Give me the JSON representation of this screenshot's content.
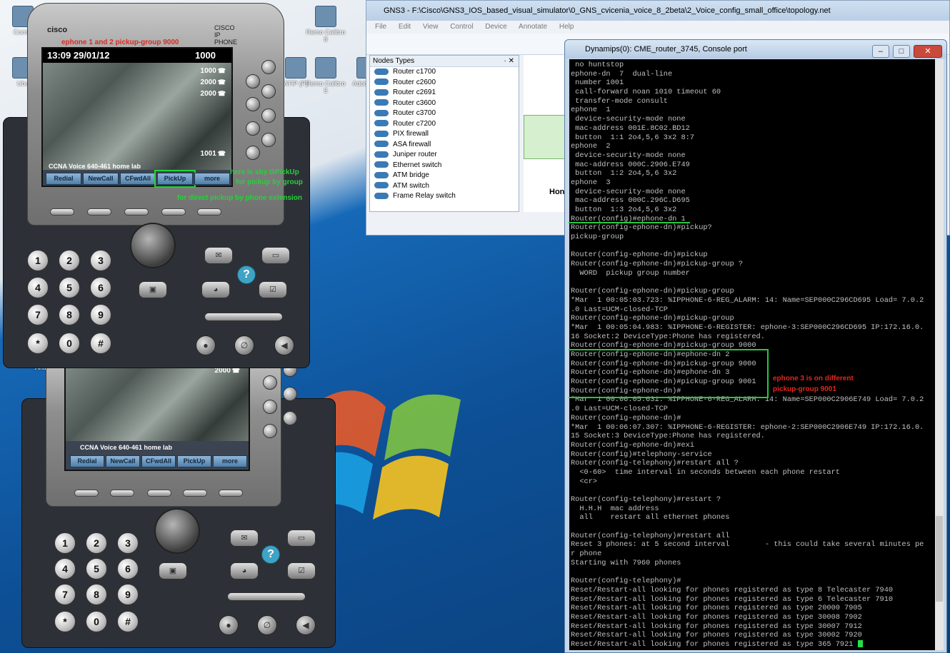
{
  "gns3": {
    "title": "GNS3 - F:\\Cisco\\GNS3_IOS_based_visual_simulator\\0_GNS_cvicenia_voice_8_2beta\\2_Voice_config_small_office\\topology.net",
    "menu": [
      "File",
      "Edit",
      "View",
      "Control",
      "Device",
      "Annotate",
      "Help"
    ],
    "nodes_title": "Nodes Types",
    "nodes_ctrl": "· ✕",
    "nodes": [
      "Router c1700",
      "Router c2600",
      "Router c2691",
      "Router c3600",
      "Router c3700",
      "Router c7200",
      "PIX firewall",
      "ASA firewall",
      "Juniper router",
      "Ethernet switch",
      "ATM bridge",
      "ATM switch",
      "Frame Relay switch"
    ],
    "canvas_label": "Hon"
  },
  "desktop_icons": [
    {
      "label": "Comm"
    },
    {
      "label": "Ubu"
    },
    {
      "label": "Antivi"
    },
    {
      "label": "Remo Calibro 8"
    },
    {
      "label": "Remo Calibro 5"
    },
    {
      "label": "Adob PDF"
    },
    {
      "label": "ATIP (P)"
    }
  ],
  "console": {
    "title": "Dynamips(0): CME_router_3745, Console port",
    "btn_min": "–",
    "btn_max": "□",
    "btn_close": "✕",
    "lines": [
      " no huntstop",
      "ephone-dn  7  dual-line",
      " number 1001",
      " call-forward noan 1010 timeout 60",
      " transfer-mode consult",
      "ephone  1",
      " device-security-mode none",
      " mac-address 001E.8C02.BD12",
      " button  1:1 2o4,5,6 3x2 8:7",
      "ephone  2",
      " device-security-mode none",
      " mac-address 000C.2906.E749",
      " button  1:2 2o4,5,6 3x2",
      "ephone  3",
      " device-security-mode none",
      " mac-address 000C.296C.D695",
      " button  1:3 2o4,5,6 3x2",
      "Router(config)#ephone-dn 1",
      "Router(config-ephone-dn)#pickup?",
      "pickup-group",
      "",
      "Router(config-ephone-dn)#pickup",
      "Router(config-ephone-dn)#pickup-group ?",
      "  WORD  pickup group number",
      "",
      "Router(config-ephone-dn)#pickup-group",
      "*Mar  1 00:05:03.723: %IPPHONE-6-REG_ALARM: 14: Name=SEP000C296CD695 Load= 7.0.2",
      ".0 Last=UCM-closed-TCP",
      "Router(config-ephone-dn)#pickup-group",
      "*Mar  1 00:05:04.983: %IPPHONE-6-REGISTER: ephone-3:SEP000C296CD695 IP:172.16.0.",
      "16 Socket:2 DeviceType:Phone has registered.",
      "Router(config-ephone-dn)#pickup-group 9000",
      "Router(config-ephone-dn)#ephone-dn 2",
      "Router(config-ephone-dn)#pickup-group 9000",
      "Router(config-ephone-dn)#ephone-dn 3",
      "Router(config-ephone-dn)#pickup-group 9001",
      "Router(config-ephone-dn)#",
      "*Mar  1 00:06:05.631: %IPPHONE-6-REG_ALARM: 14: Name=SEP000C2906E749 Load= 7.0.2",
      ".0 Last=UCM-closed-TCP",
      "Router(config-ephone-dn)#",
      "*Mar  1 00:06:07.307: %IPPHONE-6-REGISTER: ephone-2:SEP000C2906E749 IP:172.16.0.",
      "15 Socket:3 DeviceType:Phone has registered.",
      "Router(config-ephone-dn)#exi",
      "Router(config)#telephony-service",
      "Router(config-telephony)#restart all ?",
      "  <0-60>  time interval in seconds between each phone restart",
      "  <cr>",
      "",
      "Router(config-telephony)#restart ?",
      "  H.H.H  mac address",
      "  all    restart all ethernet phones",
      "",
      "Router(config-telephony)#restart all",
      "Reset 3 phones: at 5 second interval        - this could take several minutes pe",
      "r phone",
      "Starting with 7960 phones",
      "",
      "Router(config-telephony)#",
      "Reset/Restart-all looking for phones registered as type 8 Telecaster 7940",
      "Reset/Restart-all looking for phones registered as type 6 Telecaster 7910",
      "Reset/Restart-all looking for phones registered as type 20000 7905",
      "Reset/Restart-all looking for phones registered as type 30008 7902",
      "Reset/Restart-all looking for phones registered as type 30007 7912",
      "Reset/Restart-all looking for phones registered as type 30002 7920",
      "Reset/Restart-all looking for phones registered as type 365 7921 "
    ],
    "annotation_line1": "ephone 3 is on different",
    "annotation_line2": "pickup-group 9001"
  },
  "phone1": {
    "brand": "cisco",
    "model": "CISCO IP PHONE",
    "annotation_top": "ephone 1 and 2 pickup-group 9000",
    "datetime": "13:09 29/01/12",
    "ext": "1000",
    "lines": [
      "1000",
      "2000",
      "2000",
      "1001"
    ],
    "home_lab": "CCNA Voice 640-461 home lab",
    "softkeys": [
      "Redial",
      "NewCall",
      "CFwdAll",
      "PickUp",
      "more"
    ],
    "annotation_side1": "here is sby GPickUp",
    "annotation_side2": "for pickup by group",
    "annotation_side3": "for direct pickup by phone extension",
    "keypad": [
      "1",
      "2",
      "3",
      "4",
      "5",
      "6",
      "7",
      "8",
      "9",
      "*",
      "0",
      "#"
    ],
    "help": "?"
  },
  "phone2": {
    "line_top": "2000",
    "home_lab": "CCNA Voice 640-461 home lab",
    "softkeys": [
      "Redial",
      "NewCall",
      "CFwdAll",
      "PickUp",
      "more"
    ],
    "keypad": [
      "1",
      "2",
      "3",
      "4",
      "5",
      "6",
      "7",
      "8",
      "9",
      "*",
      "0",
      "#"
    ],
    "help": "?"
  },
  "icons": {
    "phone_glyph": "☎",
    "messages": "✉",
    "directories": "▭",
    "services": "◕",
    "settings": "☑",
    "headset": "●",
    "mute": "∅",
    "speaker": "◀",
    "conference": "▣"
  }
}
